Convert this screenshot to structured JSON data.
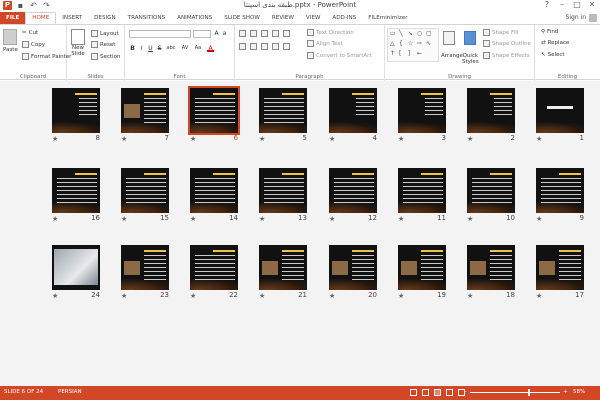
{
  "titlebar": {
    "app_icon": "P",
    "save_icon": "floppy-icon",
    "undo_icon": "undo-icon",
    "redo_icon": "redo-icon",
    "title": "طبقه بندی اسپنتا.pptx - PowerPoint",
    "help": "?",
    "min": "–",
    "max": "□",
    "close": "✕"
  },
  "tabs": [
    "FILE",
    "HOME",
    "INSERT",
    "DESIGN",
    "TRANSITIONS",
    "ANIMATIONS",
    "SLIDE SHOW",
    "REVIEW",
    "VIEW",
    "ADD-INS",
    "FILEminimizer"
  ],
  "active_tab": "HOME",
  "signin": "Sign in",
  "ribbon": {
    "clipboard": {
      "label": "Clipboard",
      "paste": "Paste",
      "cut": "Cut",
      "copy": "Copy",
      "format_painter": "Format Painter"
    },
    "slides": {
      "label": "Slides",
      "new_slide": "New",
      "new_slide_2": "Slide",
      "layout": "Layout",
      "reset": "Reset",
      "section": "Section"
    },
    "font": {
      "label": "Font",
      "bold": "B",
      "italic": "I",
      "underline": "U",
      "strike": "S",
      "shadow": "abc",
      "spacing": "AV",
      "case": "Aa",
      "color": "A"
    },
    "paragraph": {
      "label": "Paragraph",
      "text_direction": "Text Direction",
      "align_text": "Align Text",
      "convert_smartart": "Convert to SmartArt"
    },
    "drawing": {
      "label": "Drawing",
      "arrange": "Arrange",
      "quick_styles": "Quick",
      "quick_styles_2": "Styles",
      "shape_fill": "Shape Fill",
      "shape_outline": "Shape Outline",
      "shape_effects": "Shape Effects"
    },
    "editing": {
      "label": "Editing",
      "find": "Find",
      "replace": "Replace",
      "select": "Select"
    }
  },
  "slides": [
    {
      "n": "1",
      "kind": "title"
    },
    {
      "n": "2",
      "kind": "list"
    },
    {
      "n": "3",
      "kind": "list"
    },
    {
      "n": "4",
      "kind": "list"
    },
    {
      "n": "5",
      "kind": "text"
    },
    {
      "n": "6",
      "kind": "text",
      "selected": true
    },
    {
      "n": "7",
      "kind": "image"
    },
    {
      "n": "8",
      "kind": "list"
    },
    {
      "n": "9",
      "kind": "text"
    },
    {
      "n": "10",
      "kind": "text"
    },
    {
      "n": "11",
      "kind": "text"
    },
    {
      "n": "12",
      "kind": "text"
    },
    {
      "n": "13",
      "kind": "text"
    },
    {
      "n": "14",
      "kind": "text"
    },
    {
      "n": "15",
      "kind": "text"
    },
    {
      "n": "16",
      "kind": "text"
    },
    {
      "n": "17",
      "kind": "image"
    },
    {
      "n": "18",
      "kind": "image"
    },
    {
      "n": "19",
      "kind": "image"
    },
    {
      "n": "20",
      "kind": "image"
    },
    {
      "n": "21",
      "kind": "image"
    },
    {
      "n": "22",
      "kind": "text"
    },
    {
      "n": "23",
      "kind": "image"
    },
    {
      "n": "24",
      "kind": "photo"
    }
  ],
  "star": "★",
  "status": {
    "slide_info": "SLIDE 6 OF 24",
    "language": "PERSIAN",
    "zoom": "58%",
    "zoom_minus": "–",
    "zoom_plus": "+"
  }
}
